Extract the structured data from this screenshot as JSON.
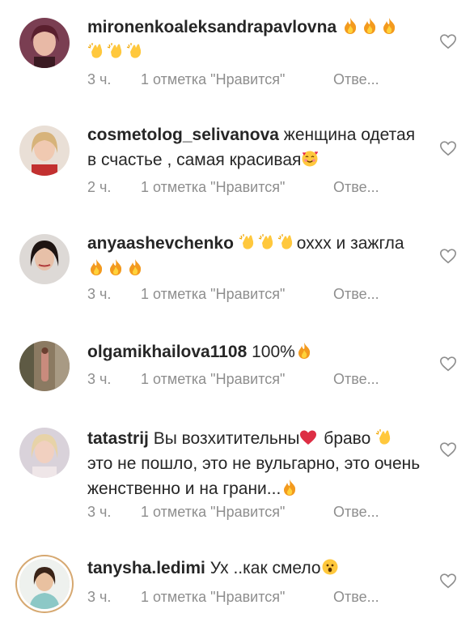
{
  "comments": [
    {
      "username": "mironenkoaleksandrapavlovna",
      "line1": " ",
      "text_after": "",
      "line2": "",
      "time": "3 ч.",
      "likes": "1 отметка \"Нравится\"",
      "reply": "Отве..."
    },
    {
      "username": "cosmetolog_selivanova",
      "text": " женщина одетая в счастье , самая красивая",
      "time": "2 ч.",
      "likes": "1 отметка \"Нравится\"",
      "reply": "Отве..."
    },
    {
      "username": "anyaashevchenko",
      "text_mid": "охxx и зажгла",
      "time": "3 ч.",
      "likes": "1 отметка \"Нравится\"",
      "reply": "Отве..."
    },
    {
      "username": "olgamikhailova1108",
      "text": " 100%",
      "time": "3 ч.",
      "likes": "1 отметка \"Нравится\"",
      "reply": "Отве..."
    },
    {
      "username": "tatastrij",
      "text_a": " Вы возхитительны",
      "text_b": " браво",
      "text_c": " это не пошло, это не вульгарно, это очень женственно и на грани...",
      "time": "3 ч.",
      "likes": "1 отметка \"Нравится\"",
      "reply": "Отве..."
    },
    {
      "username": "tanysha.ledimi",
      "text": " Ух ..как смело",
      "time": "3 ч.",
      "likes": "1 отметка \"Нравится\"",
      "reply": "Отве..."
    }
  ],
  "icons": {
    "fire": "fire-emoji",
    "clap": "clapping-hands-emoji",
    "heart": "red-heart-emoji",
    "smiling_hearts": "smiling-face-with-hearts-emoji",
    "surprised": "surprised-face-emoji",
    "like": "heart-outline-icon"
  },
  "colors": {
    "text": "#262626",
    "meta": "#8e8e8e",
    "ring": "#d6a870"
  }
}
